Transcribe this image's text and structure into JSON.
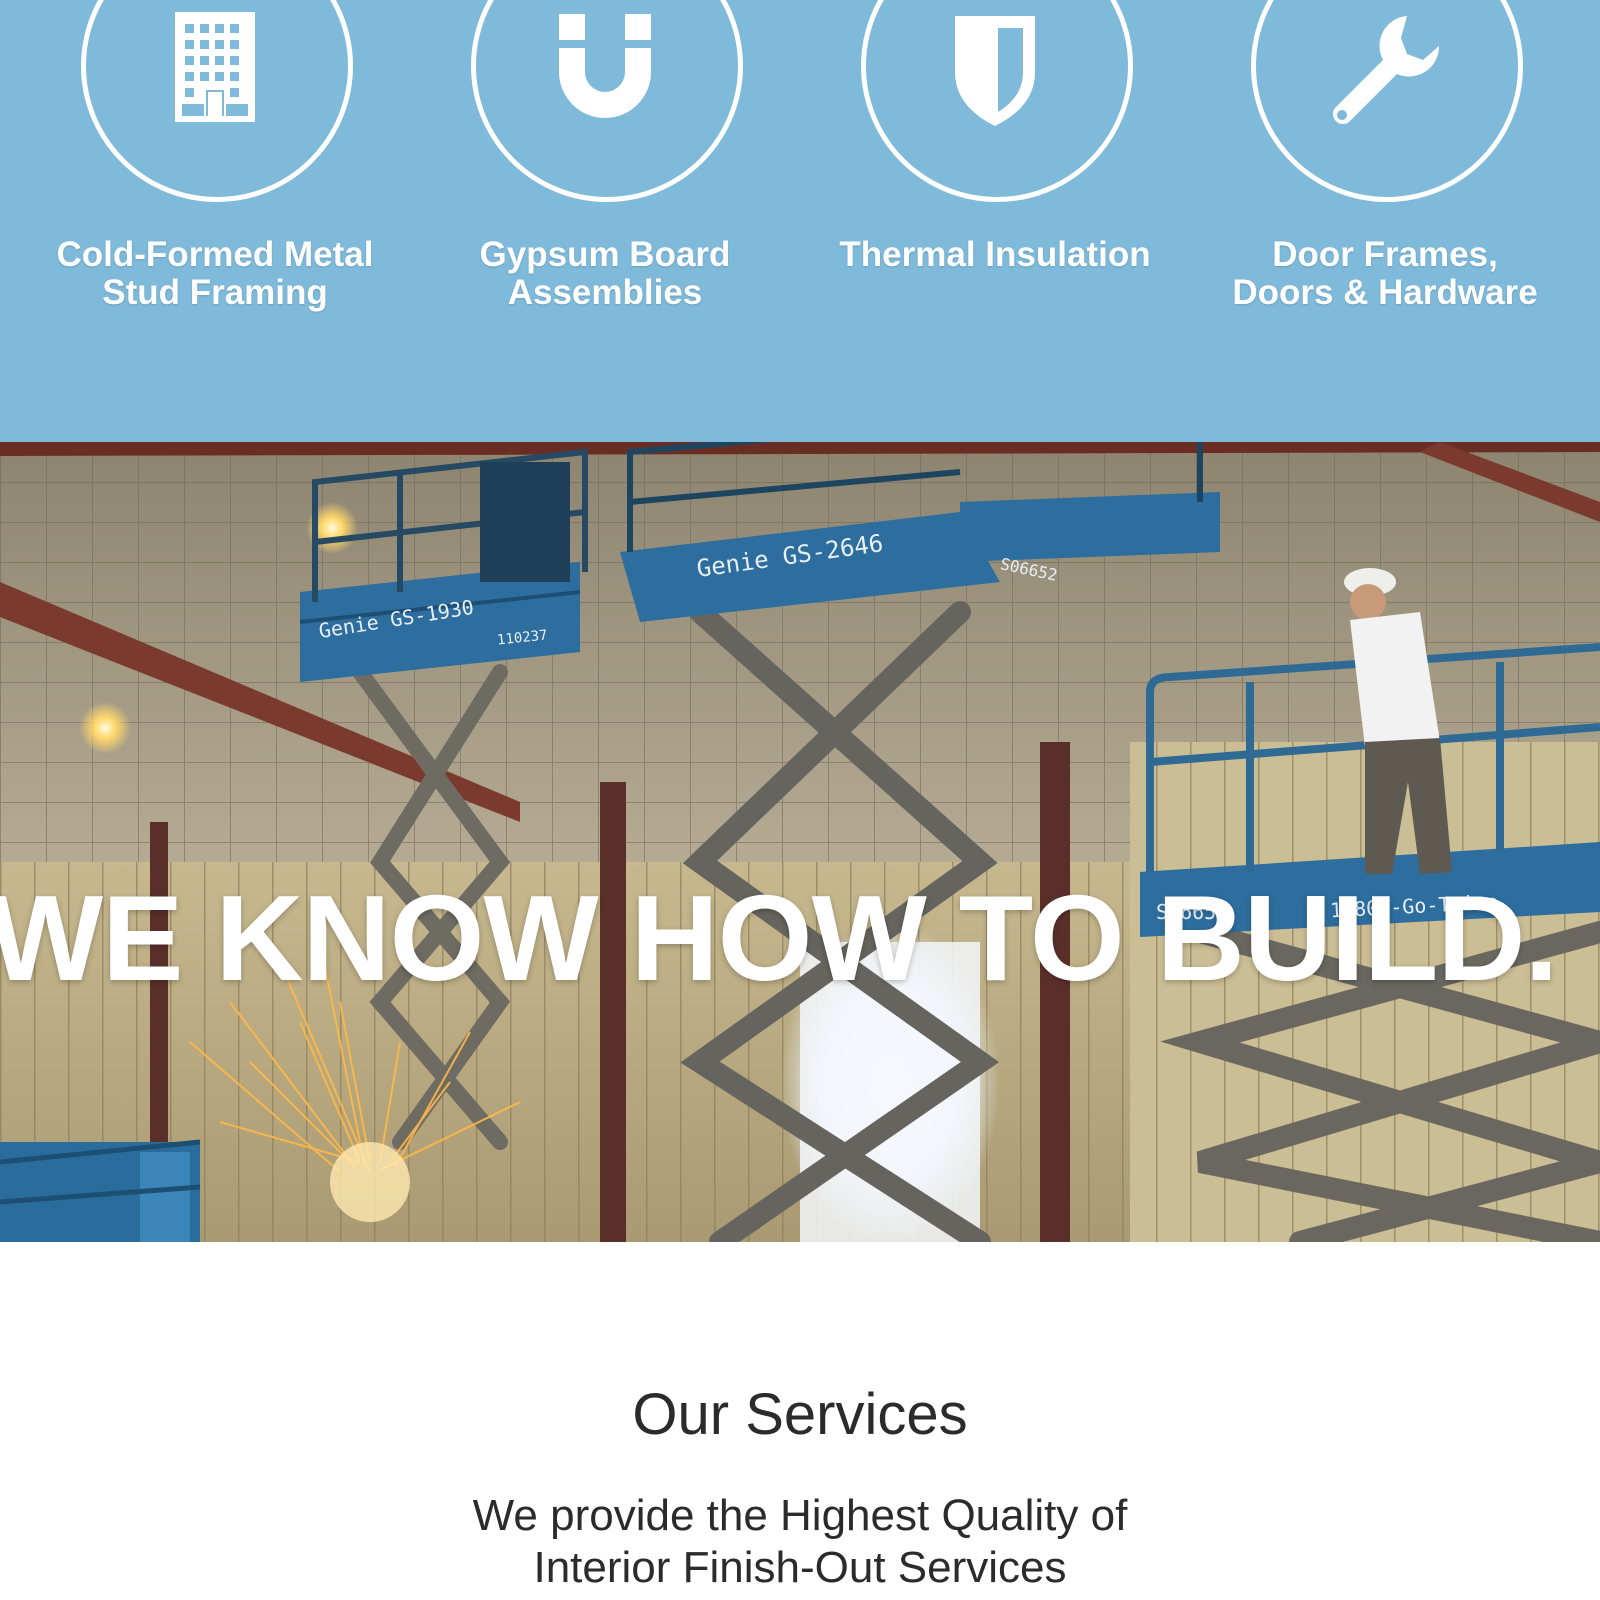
{
  "features": [
    {
      "icon": "building-icon",
      "label": "Cold-Formed Metal\nStud Framing"
    },
    {
      "icon": "magnet-icon",
      "label": "Gypsum Board\nAssemblies"
    },
    {
      "icon": "shield-icon",
      "label": "Thermal Insulation"
    },
    {
      "icon": "wrench-icon",
      "label": "Door Frames,\nDoors & Hardware"
    }
  ],
  "hero": {
    "title": "WE KNOW HOW TO BUILD.",
    "lift_labels": {
      "left": "Genie GS-1930",
      "left_id": "110237",
      "middle": "Genie GS-2646",
      "middle_id": "S06652",
      "right_id": "S06651",
      "right_brand": "Genie GS-2646",
      "right_phone": "1-800-Go-Trico"
    }
  },
  "services": {
    "title": "Our Services",
    "subtitle": "We provide the Highest Quality of\nInterior Finish-Out Services"
  },
  "colors": {
    "feature_bg": "#7fbadb",
    "lift_blue": "#2d6e9e",
    "text_dark": "#2b2b2b"
  }
}
